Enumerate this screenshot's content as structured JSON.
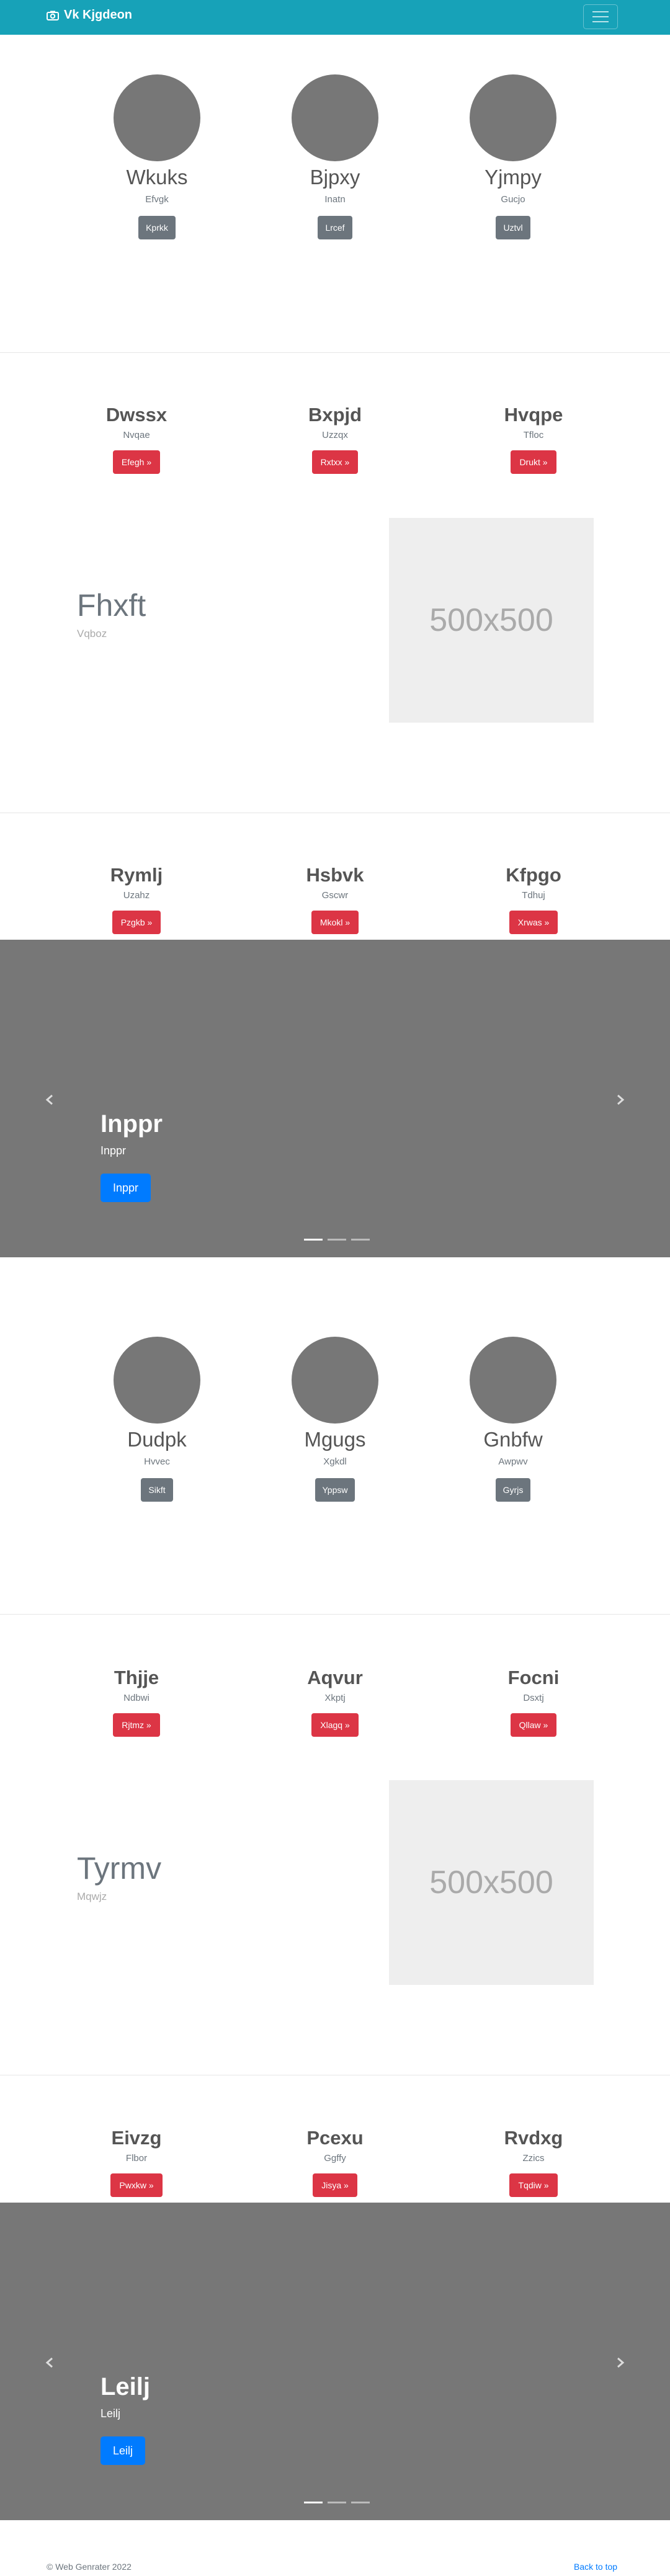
{
  "navbar": {
    "brand": "Vk Kjgdeon"
  },
  "section1": {
    "people": [
      {
        "name": "Wkuks",
        "sub": "Efvgk",
        "button": "Kprkk"
      },
      {
        "name": "Bjpxy",
        "sub": "Inatn",
        "button": "Lrcef"
      },
      {
        "name": "Yjmpy",
        "sub": "Gucjo",
        "button": "Uztvl"
      }
    ]
  },
  "section2": {
    "features": [
      {
        "title": "Dwssx",
        "sub": "Nvqae",
        "button": "Efegh »"
      },
      {
        "title": "Bxpjd",
        "sub": "Uzzqx",
        "button": "Rxtxx »"
      },
      {
        "title": "Hvqpe",
        "sub": "Tfloc",
        "button": "Drukt »"
      }
    ],
    "lead_title": "Fhxft",
    "lead_sub": "Vqboz",
    "image_label": "500x500"
  },
  "section3": {
    "features": [
      {
        "title": "Rymlj",
        "sub": "Uzahz",
        "button": "Pzgkb »"
      },
      {
        "title": "Hsbvk",
        "sub": "Gscwr",
        "button": "Mkokl »"
      },
      {
        "title": "Kfpgo",
        "sub": "Tdhuj",
        "button": "Xrwas »"
      }
    ],
    "carousel": {
      "title": "Inppr",
      "sub": "Inppr",
      "button": "Inppr"
    }
  },
  "section4": {
    "people": [
      {
        "name": "Dudpk",
        "sub": "Hvvec",
        "button": "Sikft"
      },
      {
        "name": "Mgugs",
        "sub": "Xgkdl",
        "button": "Yppsw"
      },
      {
        "name": "Gnbfw",
        "sub": "Awpwv",
        "button": "Gyrjs"
      }
    ]
  },
  "section5": {
    "features": [
      {
        "title": "Thjje",
        "sub": "Ndbwi",
        "button": "Rjtmz »"
      },
      {
        "title": "Aqvur",
        "sub": "Xkptj",
        "button": "Xlagq »"
      },
      {
        "title": "Focni",
        "sub": "Dsxtj",
        "button": "Qllaw »"
      }
    ],
    "lead_title": "Tyrmv",
    "lead_sub": "Mqwjz",
    "image_label": "500x500"
  },
  "section6": {
    "features": [
      {
        "title": "Eivzg",
        "sub": "Flbor",
        "button": "Pwxkw »"
      },
      {
        "title": "Pcexu",
        "sub": "Ggffy",
        "button": "Jisya »"
      },
      {
        "title": "Rvdxg",
        "sub": "Zzics",
        "button": "Tqdiw »"
      }
    ],
    "carousel": {
      "title": "Leilj",
      "sub": "Leilj",
      "button": "Leilj"
    }
  },
  "footer": {
    "copyright": "© Web Genrater 2022",
    "back_to_top": "Back to top"
  }
}
